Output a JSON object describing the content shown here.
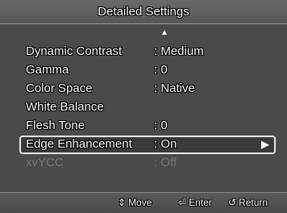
{
  "title": "Detailed Settings",
  "up_icon": "▲",
  "rows": [
    {
      "label": "Dynamic Contrast",
      "value": ": Medium"
    },
    {
      "label": "Gamma",
      "value": ": 0"
    },
    {
      "label": "Color Space",
      "value": ": Native"
    },
    {
      "label": "White Balance",
      "value": ""
    },
    {
      "label": "Flesh Tone",
      "value": ": 0"
    },
    {
      "label": "Edge Enhancement",
      "value": ": On"
    },
    {
      "label": "xvYCC",
      "value": ": Off"
    }
  ],
  "selected_arrow": "▶",
  "footer": {
    "move_icon": "⇕",
    "move": "Move",
    "enter_icon": "⏎",
    "enter": "Enter",
    "return_icon": "↺",
    "return": "Return"
  }
}
